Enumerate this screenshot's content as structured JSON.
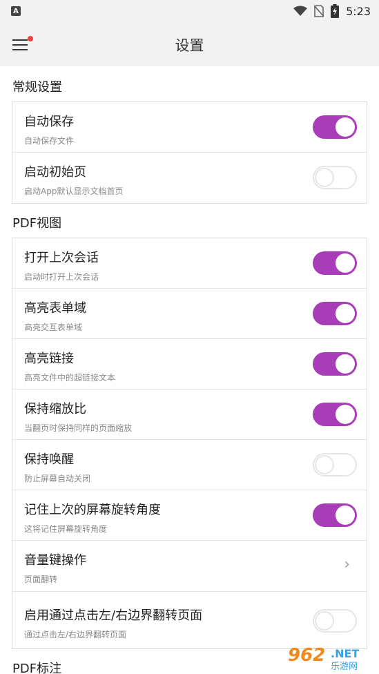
{
  "status": {
    "time": "5:23",
    "app_icon_letter": "A"
  },
  "appbar": {
    "title": "设置"
  },
  "sections": {
    "general": "常规设置",
    "pdf_view": "PDF视图",
    "pdf_annot": "PDF标注"
  },
  "general_rows": [
    {
      "title": "自动保存",
      "sub": "自动保存文件",
      "state": "on"
    },
    {
      "title": "启动初始页",
      "sub": "启动App默认显示文档首页",
      "state": "off"
    }
  ],
  "pdf_rows": [
    {
      "title": "打开上次会话",
      "sub": "启动时打开上次会话",
      "state": "on"
    },
    {
      "title": "高亮表单域",
      "sub": "高亮交互表单域",
      "state": "on"
    },
    {
      "title": "高亮链接",
      "sub": "高亮文件中的超链接文本",
      "state": "on"
    },
    {
      "title": "保持缩放比",
      "sub": "当翻页时保持同样的页面缩放",
      "state": "on"
    },
    {
      "title": "保持唤醒",
      "sub": "防止屏幕自动关闭",
      "state": "off"
    },
    {
      "title": "记住上次的屏幕旋转角度",
      "sub": "这将记住屏幕旋转角度",
      "state": "on"
    },
    {
      "title": "音量键操作",
      "sub": "页面翻转",
      "state": "chevron"
    },
    {
      "title": "启用通过点击左/右边界翻转页面",
      "sub": "通过点击左/右边界翻转页面",
      "state": "off"
    }
  ],
  "watermark": {
    "brand": "962",
    "suffix": ".NET",
    "cn": "乐游网"
  },
  "colors": {
    "accent": "#a83db8",
    "badge": "#f04040"
  }
}
